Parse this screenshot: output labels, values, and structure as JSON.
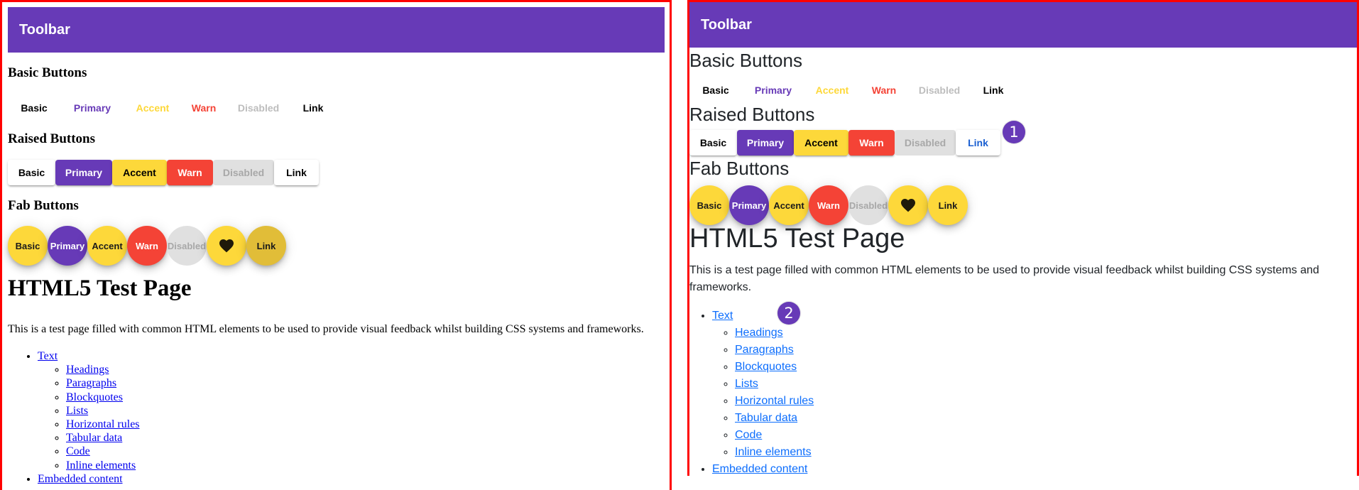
{
  "colors": {
    "primary": "#673ab7",
    "accent": "#fdd83a",
    "warn": "#f44336",
    "disabled_bg": "#e0e0e0",
    "disabled_text": "#bdbdbd",
    "frame_border": "#ff0000"
  },
  "left_panel": {
    "toolbar": {
      "title": "Toolbar"
    },
    "sections": {
      "basic": {
        "heading": "Basic Buttons",
        "buttons": [
          "Basic",
          "Primary",
          "Accent",
          "Warn",
          "Disabled",
          "Link"
        ]
      },
      "raised": {
        "heading": "Raised Buttons",
        "buttons": [
          "Basic",
          "Primary",
          "Accent",
          "Warn",
          "Disabled",
          "Link"
        ]
      },
      "fab": {
        "heading": "Fab Buttons",
        "buttons": [
          "Basic",
          "Primary",
          "Accent",
          "Warn",
          "Disabled",
          "heart-icon",
          "Link"
        ]
      }
    },
    "page": {
      "title": "HTML5 Test Page",
      "intro": "This is a test page filled with common HTML elements to be used to provide visual feedback whilst building CSS systems and frameworks.",
      "toc": [
        {
          "label": "Text",
          "children": [
            "Headings",
            "Paragraphs",
            "Blockquotes",
            "Lists",
            "Horizontal rules",
            "Tabular data",
            "Code",
            "Inline elements"
          ]
        },
        {
          "label": "Embedded content",
          "children": []
        }
      ]
    }
  },
  "right_panel": {
    "toolbar": {
      "title": "Toolbar"
    },
    "sections": {
      "basic": {
        "heading": "Basic Buttons",
        "buttons": [
          "Basic",
          "Primary",
          "Accent",
          "Warn",
          "Disabled",
          "Link"
        ]
      },
      "raised": {
        "heading": "Raised Buttons",
        "buttons": [
          "Basic",
          "Primary",
          "Accent",
          "Warn",
          "Disabled",
          "Link"
        ]
      },
      "fab": {
        "heading": "Fab Buttons",
        "buttons": [
          "Basic",
          "Primary",
          "Accent",
          "Warn",
          "Disabled",
          "heart-icon",
          "Link"
        ]
      }
    },
    "page": {
      "title": "HTML5 Test Page",
      "intro": "This is a test page filled with common HTML elements to be used to provide visual feedback whilst building CSS systems and frameworks.",
      "toc": [
        {
          "label": "Text",
          "children": [
            "Headings",
            "Paragraphs",
            "Blockquotes",
            "Lists",
            "Horizontal rules",
            "Tabular data",
            "Code",
            "Inline elements"
          ]
        },
        {
          "label": "Embedded content",
          "children": []
        }
      ]
    },
    "annotations": [
      {
        "label": "1",
        "target": "raised-link-button"
      },
      {
        "label": "2",
        "target": "toc-text-link"
      }
    ]
  }
}
